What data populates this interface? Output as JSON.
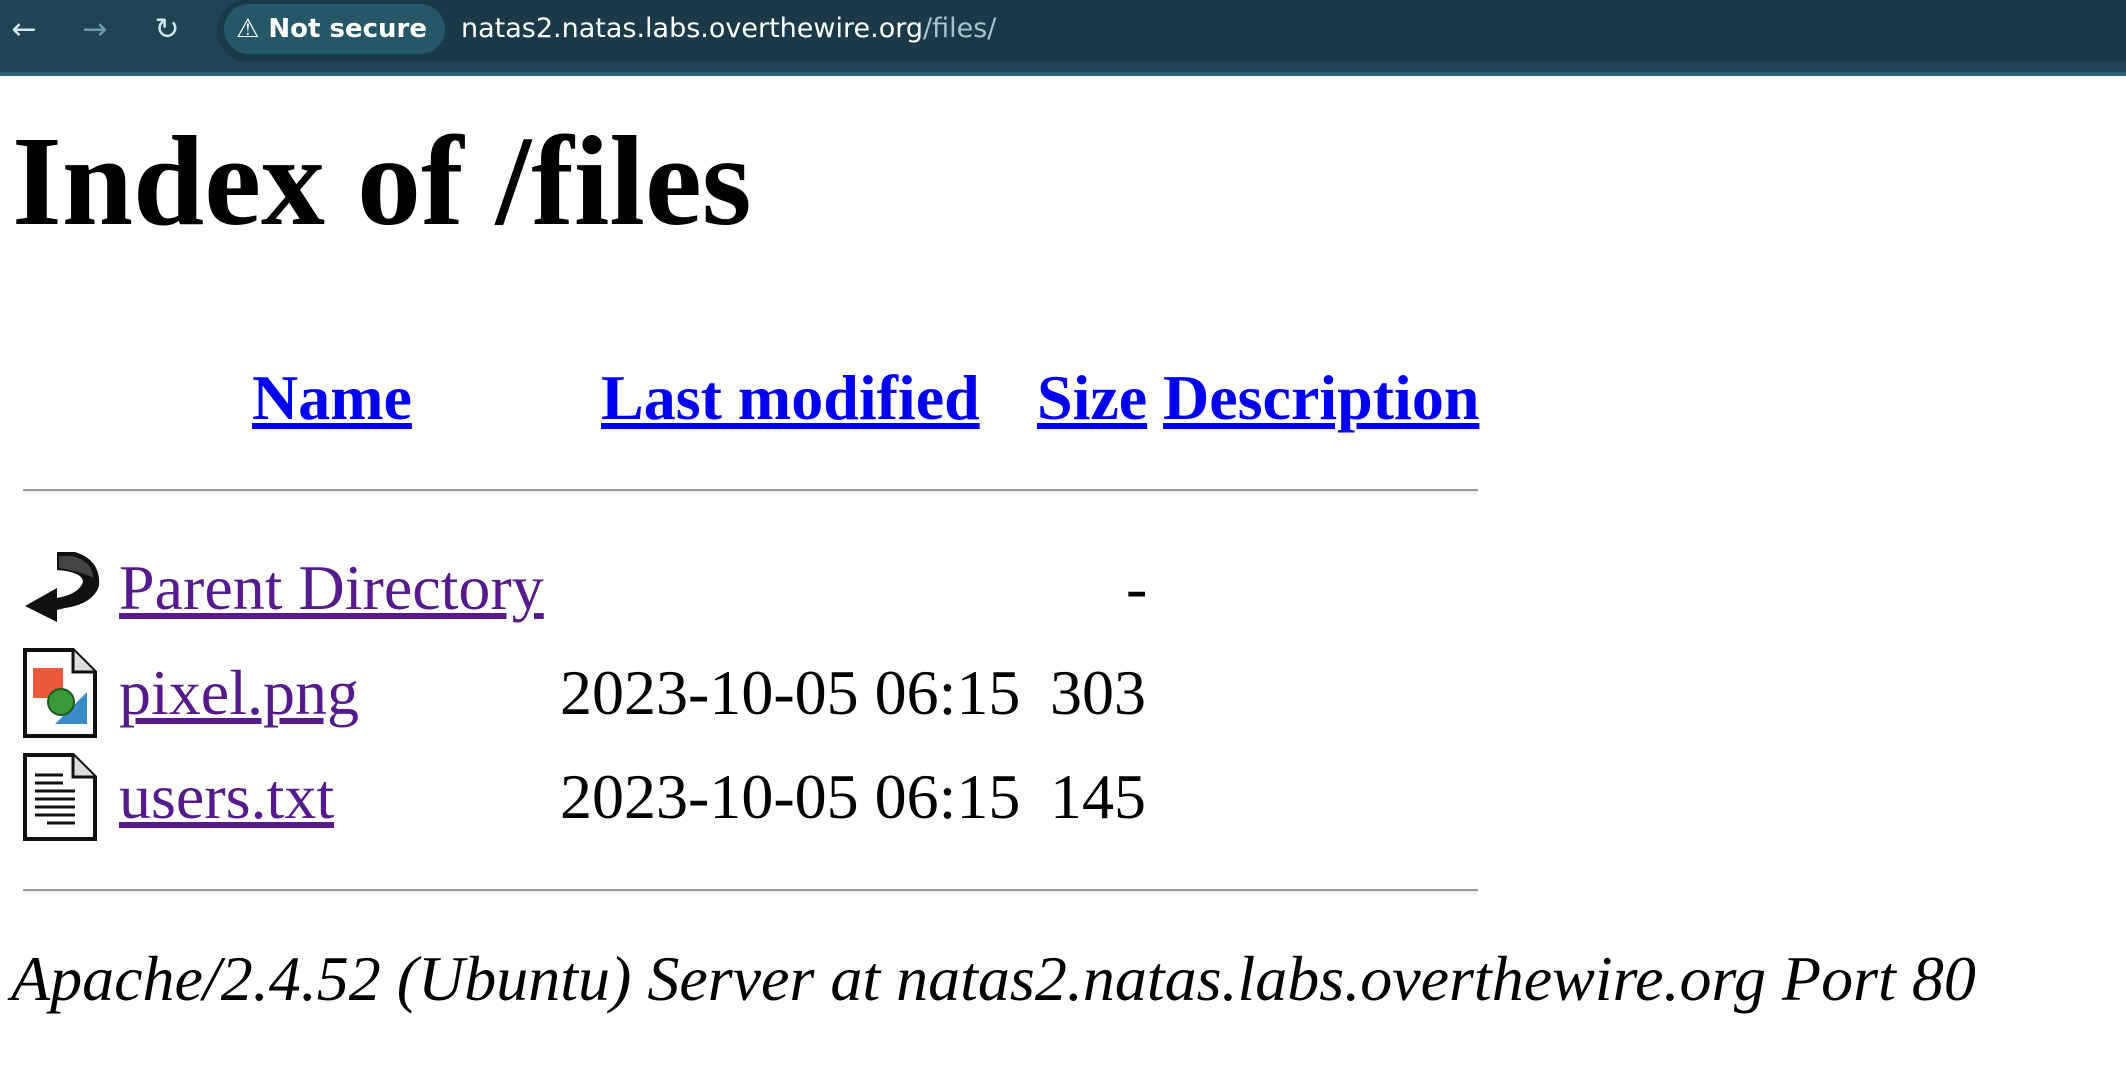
{
  "browser": {
    "back_icon": "arrow-left-icon",
    "forward_icon": "arrow-right-icon",
    "reload_icon": "reload-icon",
    "security_label": "Not secure",
    "url_host": "natas2.natas.labs.overthewire.org",
    "url_path": "/files/"
  },
  "page": {
    "title": "Index of /files",
    "columns": {
      "name": "Name",
      "last_modified": "Last modified",
      "size": "Size",
      "description": "Description"
    },
    "rows": [
      {
        "icon": "parent-directory-icon",
        "name": "Parent Directory",
        "last_modified": "",
        "size": "-",
        "description": ""
      },
      {
        "icon": "image-file-icon",
        "name": "pixel.png",
        "last_modified": "2023-10-05 06:15",
        "size": "303",
        "description": ""
      },
      {
        "icon": "text-file-icon",
        "name": "users.txt",
        "last_modified": "2023-10-05 06:15",
        "size": "145",
        "description": ""
      }
    ],
    "address": "Apache/2.4.52 (Ubuntu) Server at natas2.natas.labs.overthewire.org Port 80"
  },
  "colors": {
    "link": "#0000ee",
    "visited": "#551a8b",
    "toolbar": "#1f4454"
  }
}
